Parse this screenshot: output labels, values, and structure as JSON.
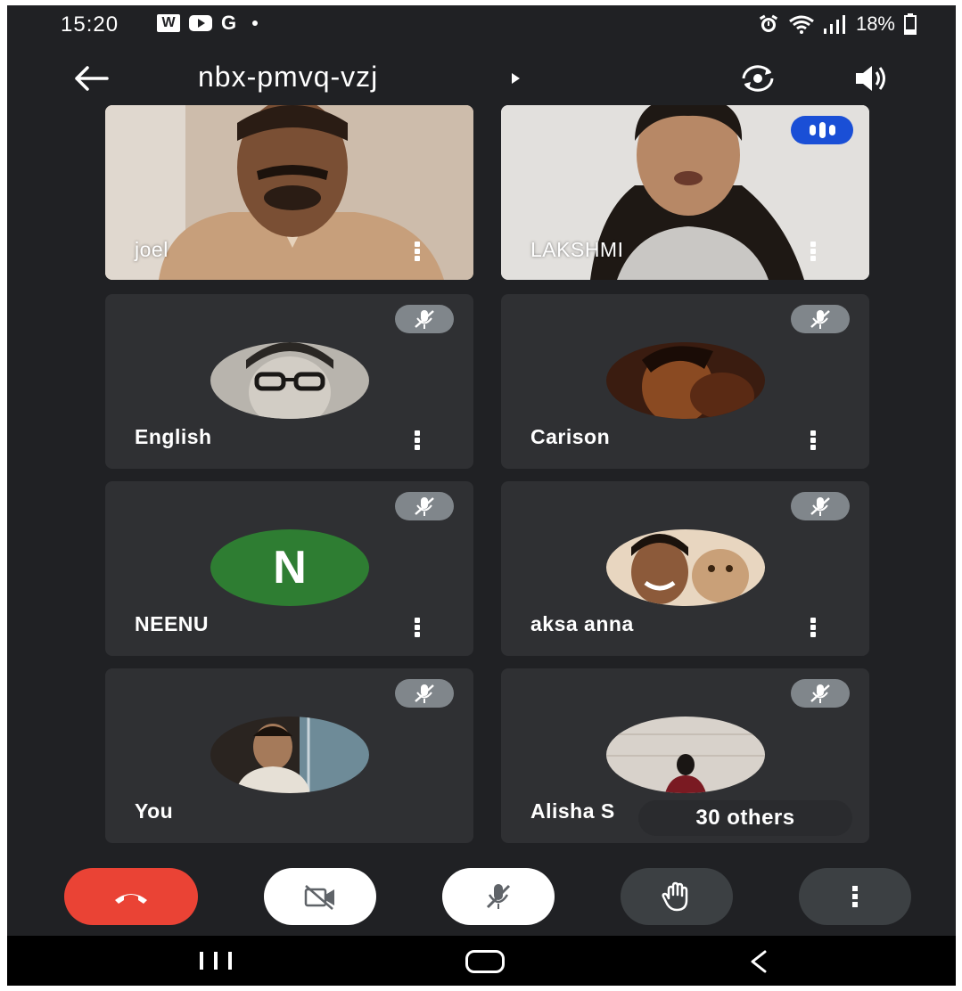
{
  "status_bar": {
    "time": "15:20",
    "apps": [
      "W",
      "youtube",
      "G"
    ],
    "battery": "18%"
  },
  "meeting": {
    "code": "nbx-pmvq-vzj"
  },
  "participants": [
    {
      "name": "joel",
      "type": "video"
    },
    {
      "name": "LAKSHMI",
      "type": "video",
      "speaking": true
    },
    {
      "name": "English",
      "type": "avatar",
      "muted": true
    },
    {
      "name": "Carison",
      "type": "avatar",
      "muted": true
    },
    {
      "name": "NEENU",
      "type": "initial",
      "initial": "N",
      "muted": true,
      "avatar_color": "#2e7d32"
    },
    {
      "name": "aksa anna",
      "type": "avatar",
      "muted": true
    },
    {
      "name": "You",
      "type": "avatar",
      "muted": true
    },
    {
      "name": "Alisha S",
      "type": "avatar",
      "muted": true
    }
  ],
  "others_pill": "30 others",
  "controls": {
    "end_call_color": "#ea4335",
    "items": [
      "end-call",
      "camera-off",
      "mic-off",
      "raise-hand",
      "more-options"
    ]
  },
  "colors": {
    "background": "#202124",
    "tile": "#2f3033",
    "speaking": "#1a4fd6",
    "mute_badge": "#80868b"
  }
}
